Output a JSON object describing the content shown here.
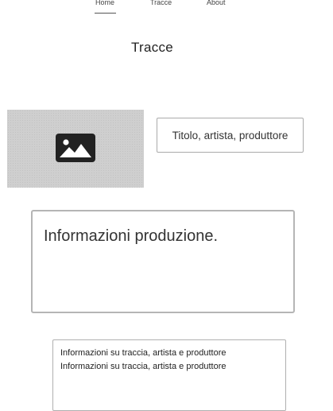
{
  "nav": {
    "items": [
      {
        "label": "Home",
        "active": true
      },
      {
        "label": "Tracce",
        "active": false
      },
      {
        "label": "About",
        "active": false
      }
    ]
  },
  "page": {
    "title": "Tracce"
  },
  "track": {
    "image_icon": "image-icon",
    "title_text": "Titolo, artista, produttore",
    "production_text": "Informazioni produzione.",
    "info_lines": [
      "Informazioni su traccia, artista e produttore",
      "Informazioni su traccia, artista e produttore"
    ]
  },
  "colors": {
    "placeholder_bg": "#cfcfcf",
    "icon": "#222222",
    "border": "#b5b5b5"
  }
}
